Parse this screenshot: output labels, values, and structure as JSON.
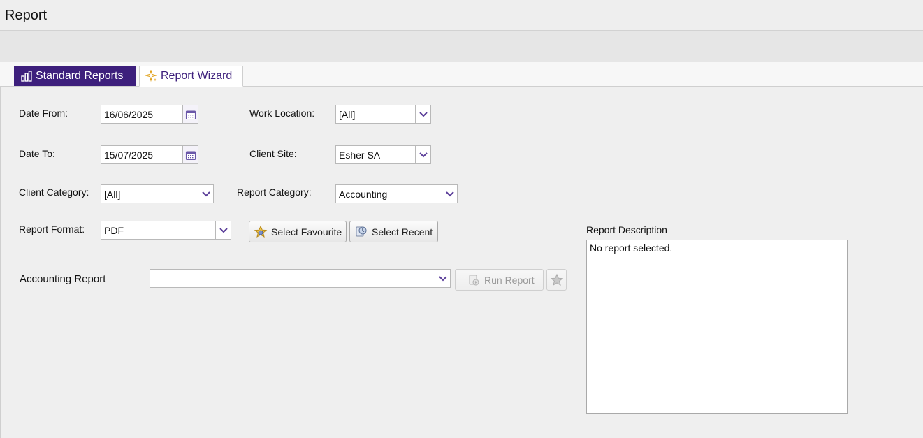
{
  "page": {
    "title": "Report"
  },
  "tabs": [
    {
      "label": "Standard Reports",
      "icon": "bar-chart-icon",
      "active": true
    },
    {
      "label": "Report Wizard",
      "icon": "sparkle-icon",
      "active": false
    }
  ],
  "form": {
    "date_from": {
      "label": "Date From:",
      "value": "16/06/2025"
    },
    "date_to": {
      "label": "Date To:",
      "value": "15/07/2025"
    },
    "work_location": {
      "label": "Work Location:",
      "value": "[All]"
    },
    "client_site": {
      "label": "Client Site:",
      "value": "Esher SA"
    },
    "client_category": {
      "label": "Client Category:",
      "value": "[All]"
    },
    "report_category": {
      "label": "Report Category:",
      "value": "Accounting"
    },
    "report_format": {
      "label": "Report Format:",
      "value": "PDF"
    },
    "accounting_report": {
      "label": "Accounting Report",
      "value": ""
    }
  },
  "buttons": {
    "select_favourite": "Select Favourite",
    "select_recent": "Select Recent",
    "run_report": "Run Report"
  },
  "description": {
    "label": "Report Description",
    "text": "No report selected."
  },
  "colors": {
    "accent": "#3d1f7c",
    "chevron": "#5a3d99"
  }
}
